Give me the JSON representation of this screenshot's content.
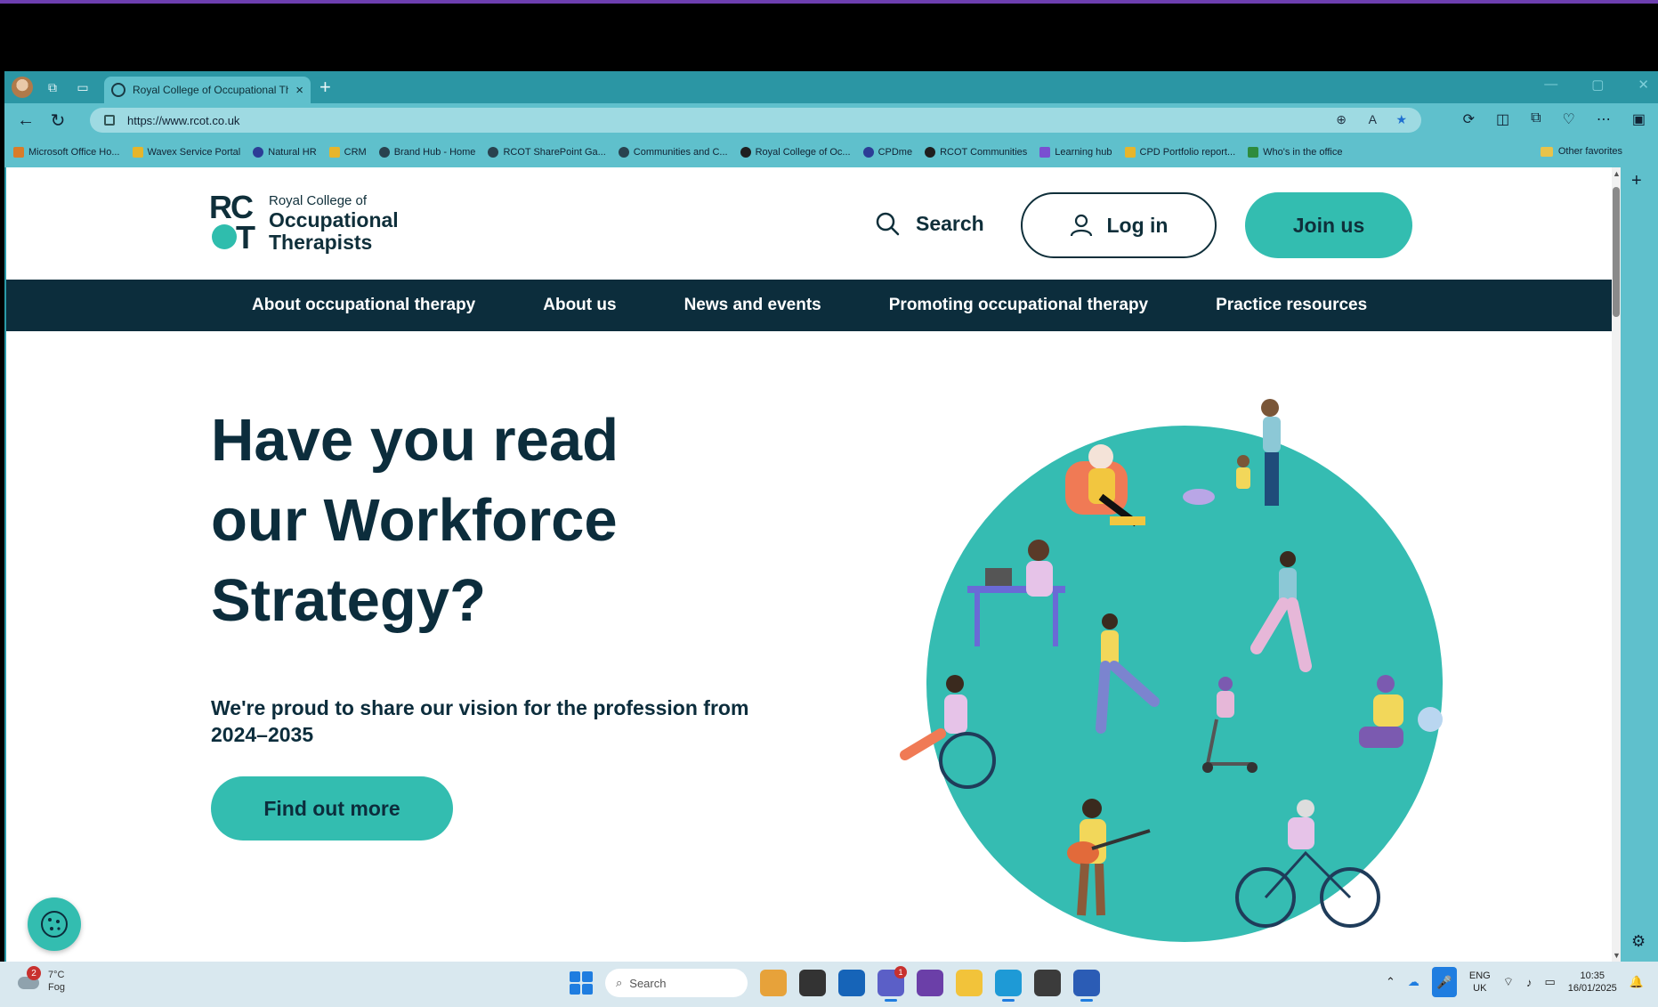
{
  "browser": {
    "tab_title": "Royal College of Occupational Th",
    "url": "https://www.rcot.co.uk",
    "favorites": [
      "Microsoft Office Ho...",
      "Wavex Service Portal",
      "Natural HR",
      "CRM",
      "Brand Hub - Home",
      "RCOT SharePoint Ga...",
      "Communities and C...",
      "Royal College of Oc...",
      "CPDme",
      "RCOT Communities",
      "Learning hub",
      "CPD Portfolio report...",
      "Who's in the office"
    ],
    "other_favorites": "Other favorites"
  },
  "site": {
    "logo": {
      "mark_top": "RC",
      "mark_bottom": "T",
      "line1": "Royal College of",
      "line2": "Occupational",
      "line3": "Therapists"
    },
    "search_label": "Search",
    "login_label": "Log in",
    "join_label": "Join us",
    "nav": [
      "About occupational therapy",
      "About us",
      "News and events",
      "Promoting occupational therapy",
      "Practice resources"
    ],
    "hero": {
      "title_line1": "Have you read",
      "title_line2": "our Workforce",
      "title_line3": "Strategy?",
      "subtitle": "We're proud to share our vision for the profession from 2024–2035",
      "cta": "Find out more"
    }
  },
  "taskbar": {
    "weather_temp": "7°C",
    "weather_desc": "Fog",
    "weather_badge": "2",
    "search_placeholder": "Search",
    "teams_badge": "1",
    "lang_top": "ENG",
    "lang_bottom": "UK",
    "time": "10:35",
    "date": "16/01/2025"
  },
  "colors": {
    "teal": "#33bdb0",
    "navy": "#0c2d3c",
    "browser_chrome": "#5fc0cc"
  }
}
